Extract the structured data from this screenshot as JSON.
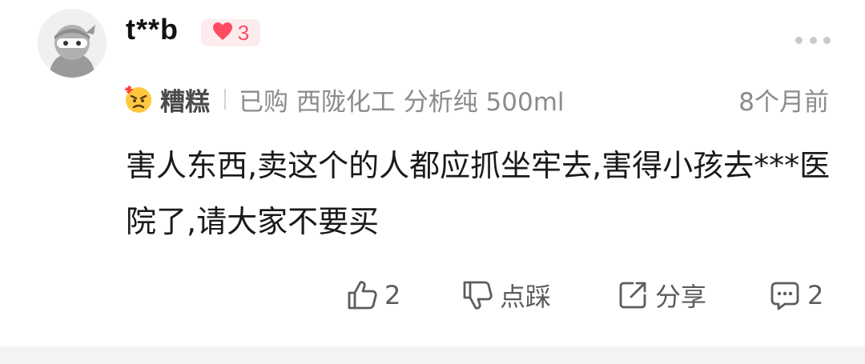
{
  "comment": {
    "username": "t**b",
    "like_badge_count": "3",
    "mood_label": "糟糕",
    "purchase_info": "已购 西陇化工 分析纯 500ml",
    "time_ago": "8个月前",
    "text": "害人东西,卖这个的人都应抓坐牢去,害得小孩去***医院了,请大家不要买"
  },
  "actions": {
    "like_count": "2",
    "dislike_label": "点踩",
    "share_label": "分享",
    "reply_count": "2"
  },
  "colors": {
    "accent_red": "#ff4a63",
    "badge_bg": "#fdecee",
    "meta_gray": "#8b8b8b",
    "action_gray": "#5c5c5c"
  },
  "icons": [
    "avatar-ninja",
    "heart-icon",
    "more-icon",
    "angry-emoji-icon",
    "thumbs-up-icon",
    "thumbs-down-icon",
    "share-icon",
    "comment-icon"
  ]
}
